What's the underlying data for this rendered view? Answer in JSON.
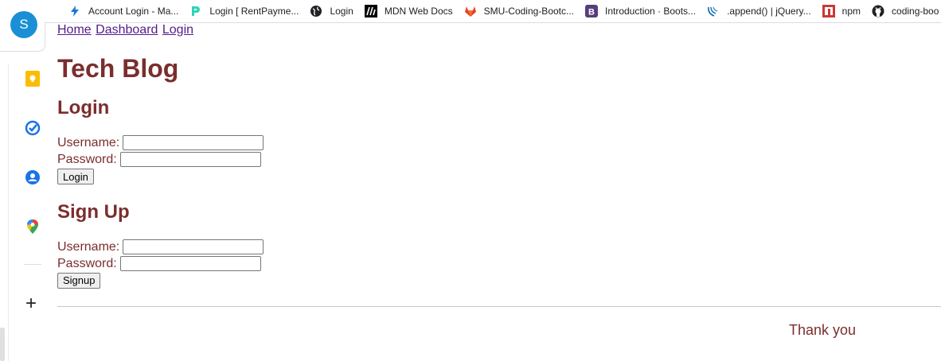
{
  "browser": {
    "profile_initial": "S",
    "bookmarks": [
      {
        "label": "Account Login - Ma...",
        "icon": "lightning-icon",
        "color": "#1a73e8"
      },
      {
        "label": "Login [ RentPayme...",
        "icon": "rentpayment-icon",
        "color": "#2fd4b5"
      },
      {
        "label": "Login",
        "icon": "globe-icon",
        "color": "#202124"
      },
      {
        "label": "MDN Web Docs",
        "icon": "mdn-icon",
        "color": "#000000"
      },
      {
        "label": "SMU-Coding-Bootc...",
        "icon": "gitlab-icon",
        "color": "#e2432a"
      },
      {
        "label": "Introduction · Boots...",
        "icon": "bootstrap-icon",
        "color": "#563d7c"
      },
      {
        "label": ".append() | jQuery...",
        "icon": "jquery-icon",
        "color": "#0868ac"
      },
      {
        "label": "npm",
        "icon": "npm-icon",
        "color": "#cb3837"
      },
      {
        "label": "coding-boo",
        "icon": "github-icon",
        "color": "#202124"
      }
    ]
  },
  "nav": {
    "home": "Home",
    "dashboard": "Dashboard",
    "login": "Login"
  },
  "page": {
    "title": "Tech Blog"
  },
  "login_form": {
    "heading": "Login",
    "username_label": "Username:",
    "username_value": "",
    "password_label": "Password:",
    "password_value": "",
    "submit": "Login"
  },
  "signup_form": {
    "heading": "Sign Up",
    "username_label": "Username:",
    "username_value": "",
    "password_label": "Password:",
    "password_value": "",
    "submit": "Signup"
  },
  "footer": {
    "text": "Thank you"
  },
  "colors": {
    "heading": "#7b2d2d",
    "link": "#551a8b"
  }
}
